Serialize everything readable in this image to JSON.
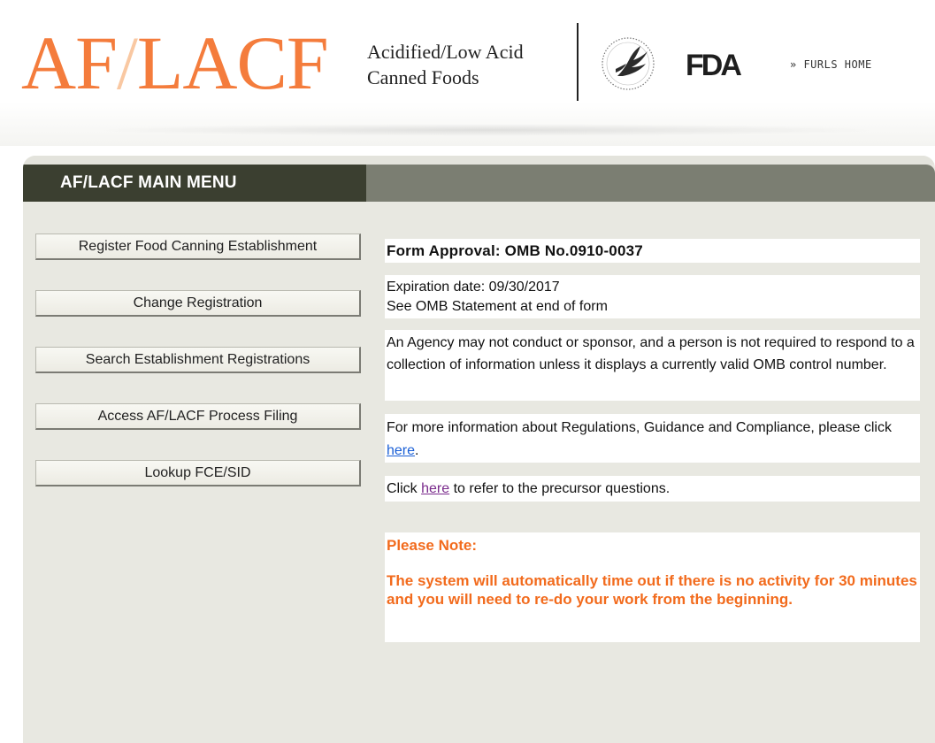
{
  "header": {
    "logo_prefix": "AF",
    "logo_slash": "/",
    "logo_suffix": "LACF",
    "tagline_line1": "Acidified/Low Acid",
    "tagline_line2": "Canned Foods",
    "hhs_icon": "hhs-eagle-seal-icon",
    "fda_icon": "fda-logo-icon",
    "fda_text": "FDA",
    "furls_link": "» FURLS HOME"
  },
  "menu": {
    "title": "AF/LACF MAIN MENU",
    "buttons": [
      "Register Food Canning Establishment",
      "Change Registration",
      "Search Establishment Registrations",
      "Access AF/LACF Process Filing",
      "Lookup FCE/SID"
    ]
  },
  "info": {
    "form_approval": "Form Approval: OMB No.0910-0037",
    "expiration_line1": "Expiration date: 09/30/2017",
    "expiration_line2": "See OMB Statement at end of form",
    "agency_text": "An Agency may not conduct or sponsor, and a person is not required to respond to a collection of information unless it displays a currently valid OMB control number.",
    "more_info_pre": "For more information about Regulations, Guidance and Compliance, please click ",
    "more_info_link": "here",
    "more_info_post": ".",
    "precursor_pre": "Click ",
    "precursor_link": "here",
    "precursor_post": " to refer to the precursor questions.",
    "note_title": "Please Note:",
    "note_text": "The system will automatically time out if there is no activity for 30 minutes and you will need to re-do your work from the beginning."
  },
  "colors": {
    "logo_orange": "#f47c3c",
    "menu_dark": "#3b3f30",
    "menu_gray": "#7b7e72",
    "panel_bg": "#e8e8e1",
    "note_orange": "#f26b1d",
    "link_blue": "#1a5fd6",
    "link_visited": "#7a2b8c"
  }
}
